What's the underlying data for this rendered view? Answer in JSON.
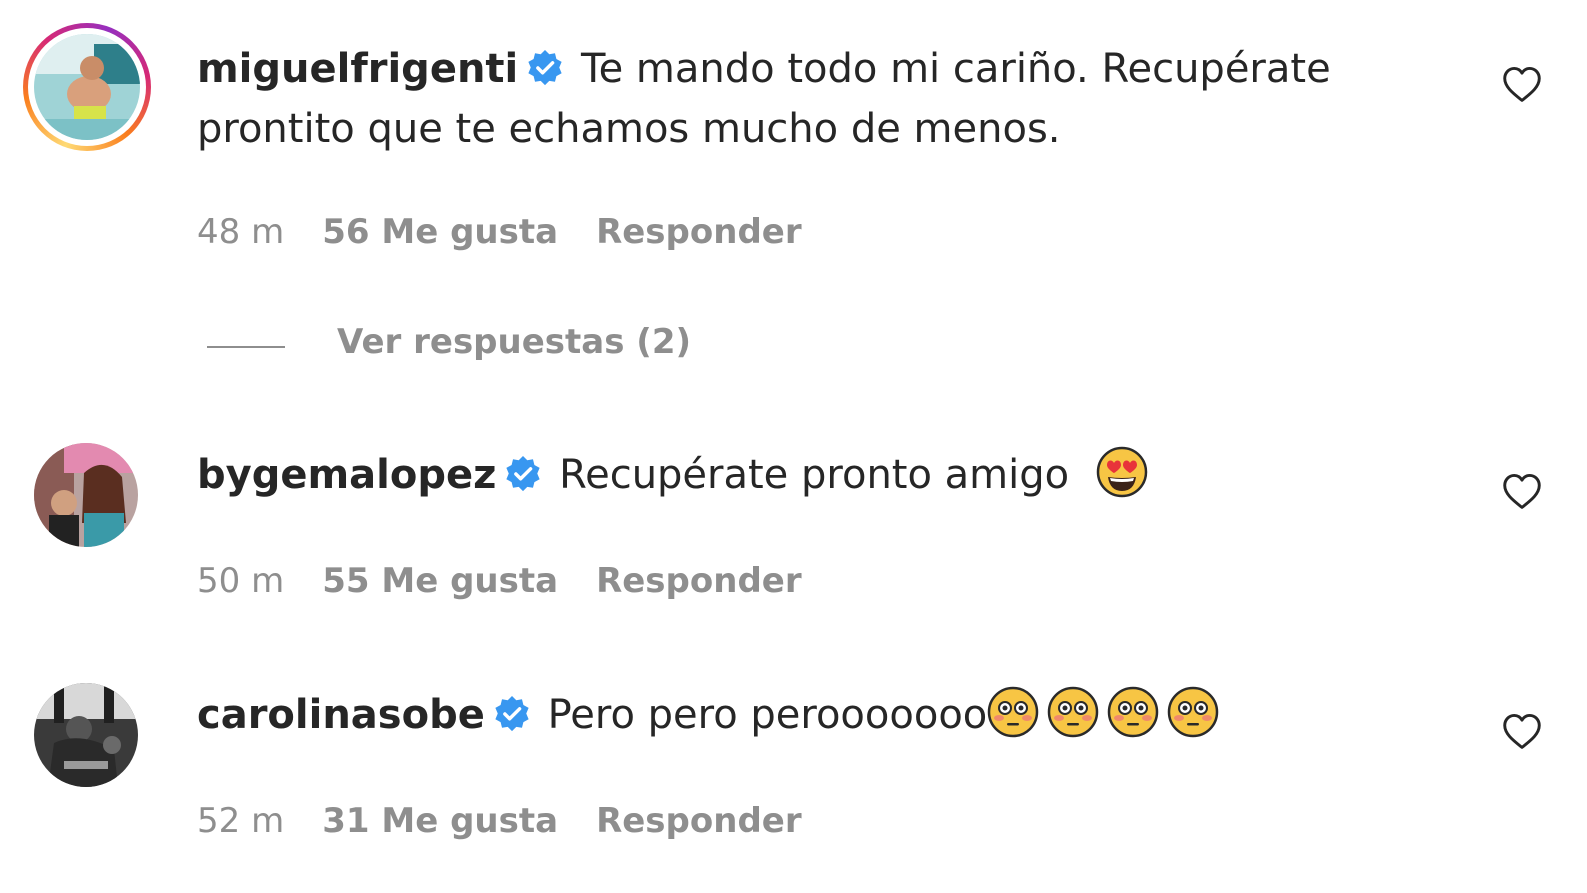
{
  "comments": [
    {
      "username": "miguelfrigenti",
      "verified": true,
      "text": "Te mando todo mi cariño. Recupérate prontito que te echamos mucho de menos.",
      "emojis": [],
      "time": "48 m",
      "likes": "56 Me gusta",
      "reply_label": "Responder",
      "has_story": true
    },
    {
      "username": "bygemalopez",
      "verified": true,
      "text": "Recupérate pronto amigo",
      "emojis": [
        "heart-eyes-emoji"
      ],
      "time": "50 m",
      "likes": "55 Me gusta",
      "reply_label": "Responder",
      "has_story": false
    },
    {
      "username": "carolinasobe",
      "verified": true,
      "text": "Pero pero perooooooo",
      "emojis": [
        "flushed-emoji",
        "flushed-emoji",
        "flushed-emoji",
        "flushed-emoji"
      ],
      "time": "52 m",
      "likes": "31 Me gusta",
      "reply_label": "Responder",
      "has_story": false
    }
  ],
  "view_replies_label": "Ver respuestas (2)",
  "colors": {
    "text": "#262626",
    "secondary": "#8e8e8e",
    "verified_blue": "#3897f0"
  },
  "icons": {
    "verified": "verified-badge-icon",
    "like": "heart-outline-icon"
  }
}
